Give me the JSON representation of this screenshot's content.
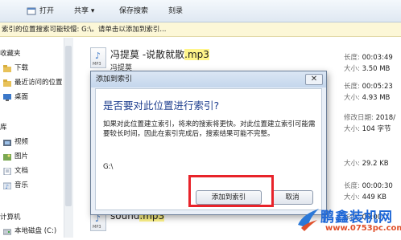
{
  "toolbar": {
    "open_label": "打开",
    "share_label": "共享 ▾",
    "save_search_label": "保存搜索",
    "burn_label": "刻录"
  },
  "infobar": {
    "text": "索引的位置搜索可能较慢: G:\\。请单击以添加到索引..."
  },
  "nav": {
    "items": [
      {
        "label": "收藏夹",
        "icon": "star-icon"
      },
      {
        "label": "下载",
        "icon": "download-folder-icon"
      },
      {
        "label": "最近访问的位置",
        "icon": "recent-places-icon"
      },
      {
        "label": "桌面",
        "icon": "desktop-icon"
      },
      {
        "label": "库",
        "icon": "library-icon"
      },
      {
        "label": "视频",
        "icon": "video-folder-icon"
      },
      {
        "label": "图片",
        "icon": "picture-folder-icon"
      },
      {
        "label": "文档",
        "icon": "document-folder-icon"
      },
      {
        "label": "音乐",
        "icon": "music-folder-icon"
      },
      {
        "label": "计算机",
        "icon": "computer-icon"
      },
      {
        "label": "本地磁盘 (C:)",
        "icon": "drive-icon"
      }
    ]
  },
  "files": {
    "rows": [
      {
        "name": "冯提莫 -说散就散",
        "ext": ".mp3",
        "sub": "冯提莫",
        "meta1_label": "长度:",
        "meta1": "00:03:49",
        "meta2_label": "大小:",
        "meta2": "3.50 MB"
      },
      {
        "name": "",
        "ext": "",
        "sub": "",
        "meta1_label": "长度:",
        "meta1": "00:05:23",
        "meta2_label": "大小:",
        "meta2": "4.93 MB"
      },
      {
        "name": "",
        "ext": "",
        "sub": "",
        "meta1_label": "修改日期:",
        "meta1": "2018/",
        "meta2_label": "大小:",
        "meta2": "104 字节"
      },
      {
        "name": "",
        "ext": "",
        "sub": "",
        "meta1_label": "",
        "meta1": "",
        "meta2_label": "大小:",
        "meta2": "29.2 KB"
      },
      {
        "name": "",
        "ext": "",
        "sub": "",
        "meta1_label": "长度:",
        "meta1": "00:00:30",
        "meta2_label": "大小:",
        "meta2": "449 KB"
      },
      {
        "name": "sound",
        "ext": ".mp3",
        "sub": "",
        "meta1_label": "长度:",
        "meta1": "00:00:",
        "meta2_label": "",
        "meta2": ""
      }
    ]
  },
  "dialog": {
    "title": "添加到索引",
    "close_symbol": "✕",
    "heading": "是否要对此位置进行索引?",
    "body": "如果对此位置建立索引，将来的搜索将更快。对此位置建立索引可能需要较长时间，因此在索引完成后，搜索结果可能不完整。",
    "path": "G:\\",
    "confirm_label": "添加到索引",
    "cancel_label": "取消"
  },
  "watermark": {
    "title": "鹏鑫装机网",
    "url": "www.0753pc.com"
  },
  "colors": {
    "highlight_box": "#e8232a",
    "search_highlight": "#fff58a",
    "heading_blue": "#1f3f8f"
  }
}
